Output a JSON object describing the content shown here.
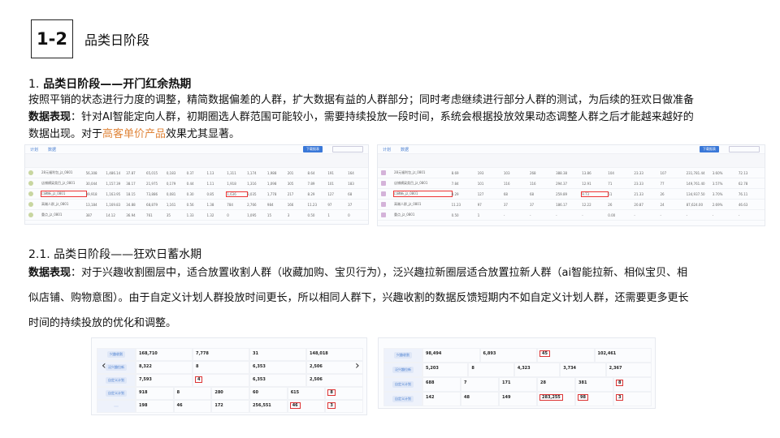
{
  "slide": {
    "number": "1-2",
    "title": "品类日阶段"
  },
  "section1": {
    "num": "1.",
    "heading": "品类日阶段——开门红余热期",
    "line1": "按照平销的状态进行力度的调整，精简数据偏差的人群，扩大数据有益的人群部分；同时考虑继续进行部分人群的测试，为后续的狂欢日做准备",
    "line2_label": "数据表现",
    "line2": "：针对AI智能定向人群，初期圈选人群范围可能较小，需要持续投放一段时间，系统会根据投放效果动态调整人群之后才能越来越好的",
    "line3_pre": "数据出现。对于",
    "line3_highlight": "高客单价产品",
    "line3_post": "效果尤其显著。"
  },
  "section2": {
    "heading": "2.1. 品类日阶段——狂欢日蓄水期",
    "line1_label": "数据表现",
    "line1": "：对于兴趣收割圈层中，适合放置收割人群（收藏加购、宝贝行为），泛兴趣拉新圈层适合放置拉新人群（ai智能拉新、相似宝贝、相",
    "line2": "似店铺、购物意图）。由于自定义计划人群投放时间更长，所以相同人群下，兴趣收割的数据反馈短期内不如自定义计划人群，还需要更多更长",
    "line3": "时间的持续投放的优化和调整。"
  },
  "screenshot_a": {
    "tabs": [
      "计划",
      "数据"
    ],
    "button": "下载报表",
    "search": "搜索",
    "rows": [
      [
        "28元福利包_jz_0801",
        "56,308",
        "1,486.14",
        "37.87",
        "65,015",
        "0,183",
        "0.37",
        "1.13",
        "1,311",
        "1,174",
        "1,988",
        "201",
        "8.64",
        "191",
        "164"
      ],
      [
        "店铺横梁类目_jz_0801",
        "30,044",
        "1,157.39",
        "38.17",
        "21,975",
        "0,179",
        "0.44",
        "1.11",
        "1,918",
        "1,316",
        "1,098",
        "305",
        "7.89",
        "101",
        "183"
      ],
      [
        "口碑新_jz_0801",
        "39,918",
        "1,163.95",
        "18.15",
        "73,886",
        "0,081",
        "0.30",
        "0.85",
        "1,636",
        "3,035",
        "1,778",
        "217",
        "8.29",
        "127",
        "68"
      ],
      [
        "高端人群_jz_0801",
        "13,184",
        "1,169.83",
        "34.88",
        "68,879",
        "1,161",
        "0.56",
        "1.38",
        "784",
        "2,766",
        "984",
        "166",
        "11.23",
        "97",
        "37"
      ],
      [
        "重点_jz_0801",
        "387",
        "14.12",
        "36.94",
        "761",
        "35",
        "1.33",
        "1.32",
        "0",
        "1,095",
        "15",
        "3",
        "0.50",
        "1",
        "0"
      ]
    ]
  },
  "screenshot_b": {
    "tabs": [
      "计划",
      "数据"
    ],
    "button": "下载报表",
    "search": "搜索",
    "rows": [
      [
        "28元福利包_jz_0801",
        "8.69",
        "193",
        "103",
        "268",
        "388.38",
        "13.86",
        "104",
        "23.33",
        "107",
        "231,781.44",
        "3.60%",
        "72.13"
      ],
      [
        "店铺横梁类目_jz_0801",
        "7.84",
        "101",
        "116",
        "116",
        "294.37",
        "12.91",
        "71",
        "23.33",
        "77",
        "149,761.40",
        "3.57%",
        "62.78"
      ],
      [
        "口碑新_jz_0801",
        "8.29",
        "127",
        "68",
        "68",
        "259.89",
        "9.73",
        "51",
        "21.33",
        "26",
        "134,937.50",
        "3.70%",
        "76.11"
      ],
      [
        "高端人群_jz_0801",
        "11.23",
        "97",
        "37",
        "37",
        "186.17",
        "12.22",
        "26",
        "20.87",
        "24",
        "87,624.00",
        "2.69%",
        "46.63"
      ],
      [
        "重点_jz_0801",
        "0.50",
        "1",
        "-",
        "-",
        "-",
        "-",
        "0.00",
        "-",
        "-",
        "-",
        "-",
        "-"
      ]
    ]
  },
  "screenshot_c": {
    "labels": [
      "兴趣收割",
      "泛兴趣拉新",
      "自定义计划",
      "自定义计划"
    ],
    "cells": [
      [
        "168,710",
        "7,778",
        "31",
        "148,018"
      ],
      [
        "8,322",
        "8",
        "6,353",
        "2,506"
      ],
      [
        "7,593",
        "4",
        "6,353",
        "2,506"
      ],
      [
        "918",
        "8",
        "280",
        "60",
        "615",
        "8"
      ],
      [
        "198",
        "46",
        "172",
        "256,551",
        "46",
        "3"
      ]
    ]
  },
  "screenshot_d": {
    "labels": [
      "兴趣收割",
      "泛兴趣拉新",
      "自定义计划",
      "自定义计划"
    ],
    "cells": [
      [
        "98,494",
        "6,893",
        "45",
        "102,461"
      ],
      [
        "5,203",
        "8",
        "4,323",
        "3,734",
        "2,367"
      ],
      [
        "688",
        "7",
        "171",
        "28",
        "381",
        "8"
      ],
      [
        "142",
        "48",
        "149",
        "283,255",
        "98",
        "3"
      ]
    ]
  }
}
